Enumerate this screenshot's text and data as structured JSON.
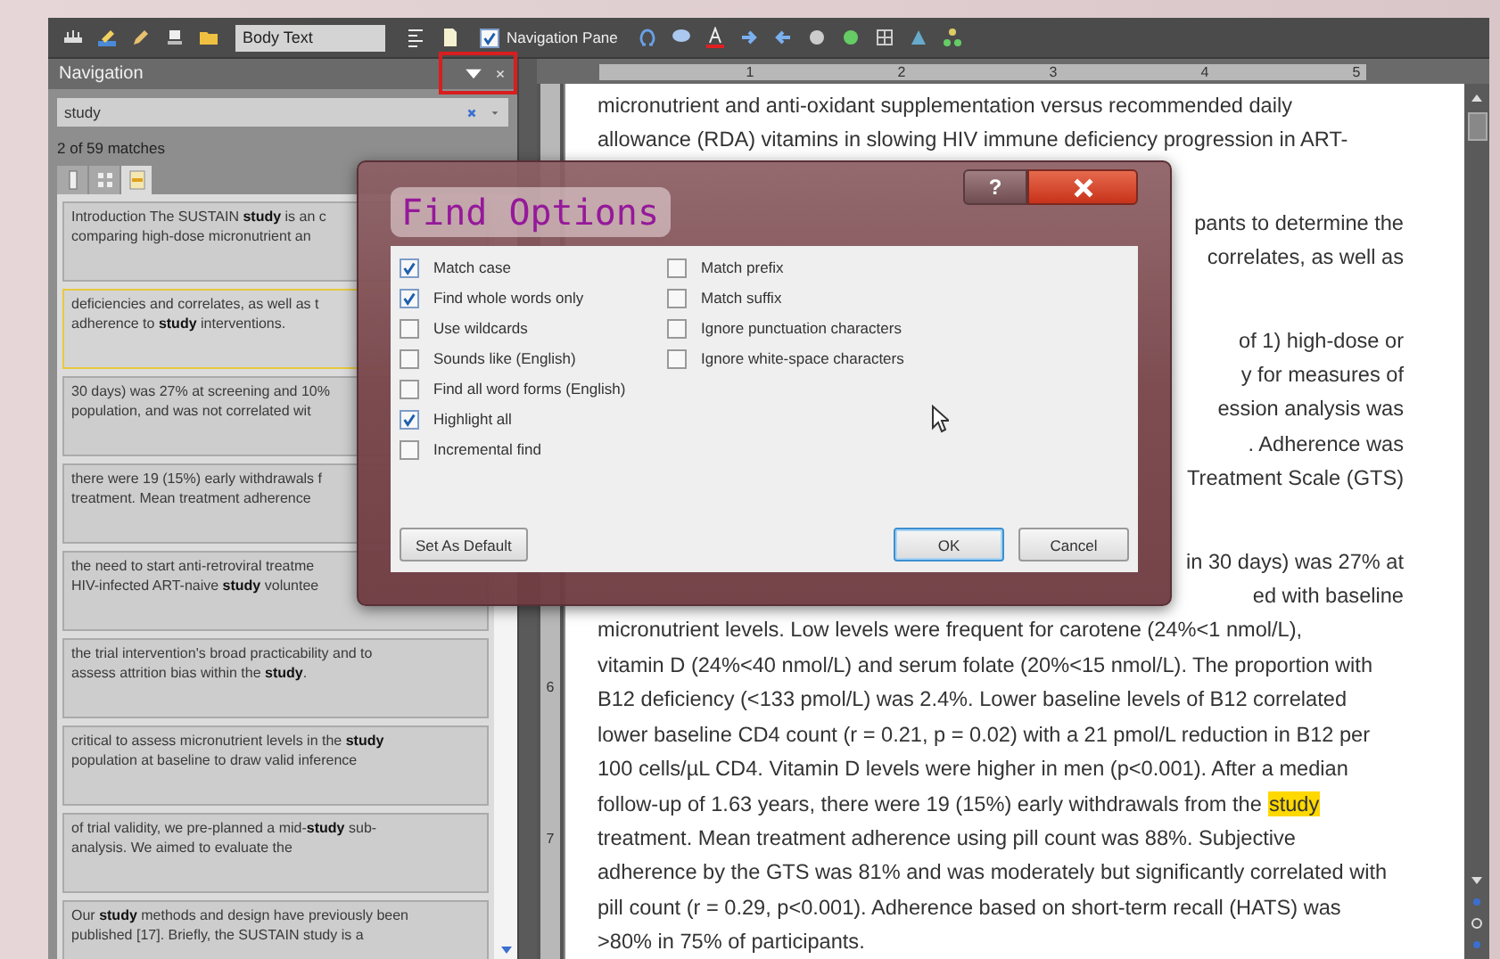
{
  "toolbar": {
    "style_box": "Body Text",
    "navigation_pane": {
      "label": "Navigation Pane",
      "checked": true
    }
  },
  "navigation": {
    "title": "Navigation",
    "search": {
      "value": "study"
    },
    "match_count": "2 of 59 matches",
    "view_tabs": [
      {
        "kind": "headings",
        "selected": false
      },
      {
        "kind": "pages",
        "selected": false
      },
      {
        "kind": "results",
        "selected": true
      }
    ],
    "results": [
      {
        "lines": [
          "Introduction The SUSTAIN **study** is an c",
          "comparing high-dose micronutrient an"
        ],
        "selected": false
      },
      {
        "lines": [
          "deficiencies and correlates, as well as t",
          "adherence to **study** interventions."
        ],
        "selected": true
      },
      {
        "lines": [
          "30 days) was 27% at screening and 10%",
          "population, and was not correlated wit"
        ],
        "selected": false
      },
      {
        "lines": [
          "there were 19 (15%) early withdrawals f",
          "treatment. Mean treatment adherence"
        ],
        "selected": false
      },
      {
        "lines": [
          "the need to start anti-retroviral treatme",
          "HIV-infected ART-naive **study** voluntee"
        ],
        "selected": false
      },
      {
        "lines": [
          "the trial intervention's broad practicability and to",
          "assess attrition bias within the **study**."
        ],
        "selected": false
      },
      {
        "lines": [
          "critical to assess micronutrient levels in the **study**",
          "population at baseline to draw valid inference"
        ],
        "selected": false
      },
      {
        "lines": [
          "of trial validity, we pre-planned a mid-**study** sub-",
          "analysis. We aimed to evaluate the"
        ],
        "selected": false
      },
      {
        "lines": [
          "Our **study** methods and design have previously been",
          "published [17]. Briefly, the SUSTAIN study is a"
        ],
        "selected": false
      }
    ]
  },
  "ruler": {
    "marks": [
      "1",
      "2",
      "3",
      "4",
      "5"
    ]
  },
  "vertical_ruler": {
    "marks": [
      "6",
      "7"
    ]
  },
  "document": {
    "paragraphs": [
      {
        "lines": [
          {
            "kind": "full",
            "text": "micronutrient and anti-oxidant supplementation versus recommended daily"
          },
          {
            "kind": "full",
            "text": "allowance (RDA) vitamins in slowing HIV immune deficiency progression in ART-"
          }
        ]
      },
      {
        "lines": [
          {
            "kind": "fragment",
            "text": "pants to determine the"
          },
          {
            "kind": "fragment",
            "text": "correlates, as well as"
          }
        ]
      },
      {
        "lines": [
          {
            "kind": "fragment",
            "text": "of 1) high-dose or"
          },
          {
            "kind": "fragment",
            "text": "y for measures of"
          },
          {
            "kind": "fragment",
            "text": "ession analysis was"
          },
          {
            "kind": "fragment",
            "text": ". Adherence was"
          },
          {
            "kind": "fragment",
            "text": "Treatment Scale (GTS)"
          }
        ]
      },
      {
        "lines": [
          {
            "kind": "fragment",
            "text": "in 30 days) was 27% at"
          },
          {
            "kind": "fragment",
            "text": "ed with baseline"
          },
          {
            "kind": "full",
            "text": "micronutrient levels. Low levels were frequent for carotene (24%<1 nmol/L),"
          },
          {
            "kind": "full",
            "text": "vitamin D (24%<40 nmol/L) and serum folate (20%<15 nmol/L). The proportion with"
          },
          {
            "kind": "full",
            "text": "B12 deficiency (<133 pmol/L) was 2.4%. Lower baseline levels of B12 correlated"
          },
          {
            "kind": "full",
            "text": "lower baseline CD4 count (r = 0.21, p = 0.02) with a 21 pmol/L reduction in B12 per"
          },
          {
            "kind": "full",
            "text": "100 cells/µL CD4. Vitamin D levels were higher in men (p<0.001). After a median"
          },
          {
            "kind": "full",
            "text": "follow-up of 1.63 years, there were 19 (15%) early withdrawals from the",
            "highlight": "study"
          },
          {
            "kind": "full",
            "text": "treatment. Mean treatment adherence using pill count was 88%. Subjective"
          },
          {
            "kind": "full",
            "text": "adherence by the GTS was 81% and was moderately but significantly correlated with"
          },
          {
            "kind": "full",
            "text": "pill count (r = 0.29, p<0.001). Adherence based on short-term recall (HATS) was"
          },
          {
            "kind": "full",
            "text": ">80% in 75% of participants."
          }
        ]
      }
    ]
  },
  "dialog": {
    "title": "Find Options",
    "help": "?",
    "options_left": [
      {
        "label": "Match case",
        "checked": true
      },
      {
        "label": "Find whole words only",
        "checked": true
      },
      {
        "label": "Use wildcards",
        "checked": false
      },
      {
        "label": "Sounds like (English)",
        "checked": false
      },
      {
        "label": "Find all word forms (English)",
        "checked": false
      },
      {
        "label": "Highlight all",
        "checked": true
      },
      {
        "label": "Incremental find",
        "checked": false
      }
    ],
    "options_right": [
      {
        "label": "Match prefix",
        "checked": false
      },
      {
        "label": "Match suffix",
        "checked": false
      },
      {
        "label": "Ignore punctuation characters",
        "checked": false
      },
      {
        "label": "Ignore white-space characters",
        "checked": false
      }
    ],
    "set_default_button": "Set As Default",
    "buttons": [
      {
        "label": "OK",
        "default": true
      },
      {
        "label": "Cancel",
        "default": false
      }
    ]
  }
}
